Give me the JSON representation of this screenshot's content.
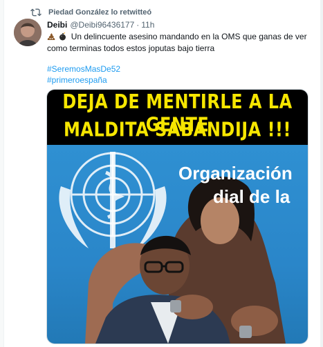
{
  "retweet": {
    "text": "Piedad González lo retwitteó"
  },
  "tweet": {
    "display_name": "Deibi",
    "handle": "@Deibi96436177",
    "separator": "·",
    "time": "11h",
    "text": "Un delincuente asesino mandando en la OMS que ganas de ver como terminas todos estos joputas bajo tierra",
    "hashtags": [
      "#SeremosMasDe52",
      "#primeroespaña"
    ]
  },
  "media": {
    "banner_line1": "DEJA DE MENTIRLE A LA GENTE",
    "banner_line2": "MALDITA SABANDIJA !!!",
    "photo_text_line1": "Organización",
    "photo_text_line2": "dial de la"
  },
  "colors": {
    "accent": "#1d9bf0",
    "banner_text": "#f6e600",
    "who_blue": "#2f90d2"
  }
}
